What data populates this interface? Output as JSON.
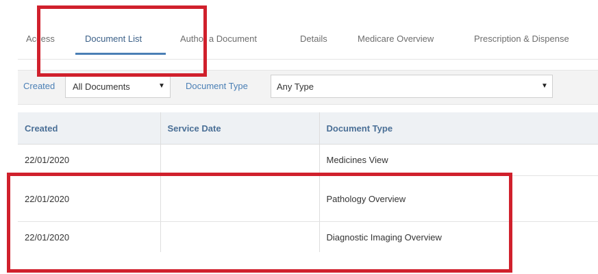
{
  "tabs": [
    {
      "label": "Access"
    },
    {
      "label": "Document List",
      "active": true
    },
    {
      "label": "Author a Document"
    },
    {
      "label": "Details"
    },
    {
      "label": "Medicare Overview"
    },
    {
      "label": "Prescription & Dispense"
    }
  ],
  "filters": {
    "created_label": "Created",
    "created_value": "All Documents",
    "doctype_label": "Document Type",
    "doctype_value": "Any Type"
  },
  "table": {
    "columns": [
      "Created",
      "Service Date",
      "Document Type"
    ],
    "rows": [
      {
        "created": "22/01/2020",
        "service_date": "",
        "document_type": "Medicines View"
      },
      {
        "created": "22/01/2020",
        "service_date": "",
        "document_type": "Pathology Overview"
      },
      {
        "created": "22/01/2020",
        "service_date": "",
        "document_type": "Diagnostic Imaging Overview"
      }
    ]
  },
  "colors": {
    "accent": "#4a7fb5",
    "highlight": "#d0202c"
  }
}
